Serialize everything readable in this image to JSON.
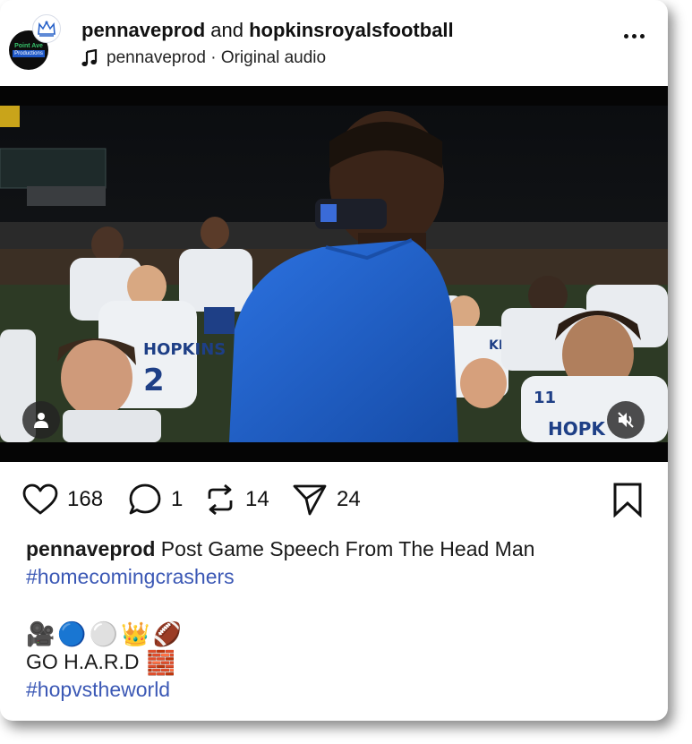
{
  "header": {
    "author1": "pennaveprod",
    "joiner": " and ",
    "author2": "hopkinsroyalsfootball",
    "audio_owner": "pennaveprod",
    "audio_sep": " · ",
    "audio_label": "Original audio",
    "avatar_logo_top": "Point Ave",
    "avatar_logo_bottom": "Productions"
  },
  "actions": {
    "likes": "168",
    "comments": "1",
    "reposts": "14",
    "shares": "24"
  },
  "caption": {
    "username": "pennaveprod",
    "text": " Post Game Speech From The Head Man",
    "hashtag1": "#homecomingcrashers",
    "emojis": [
      "🎥",
      "🔵",
      "⚪",
      "👑",
      "🏈"
    ],
    "line2": "GO H.A.R.D",
    "line2_emoji": "🧱",
    "hashtag2": "#hopvstheworld"
  },
  "video": {
    "jersey1": "HOPKINS",
    "jersey2": "2",
    "jersey3": "HOPK",
    "jersey4": "KINS",
    "jersey5": "11"
  },
  "colors": {
    "link": "#3b58b5",
    "coach_shirt": "#1f5fd1",
    "jersey_white": "#e9ecf0",
    "jersey_blue": "#1e3f86"
  }
}
